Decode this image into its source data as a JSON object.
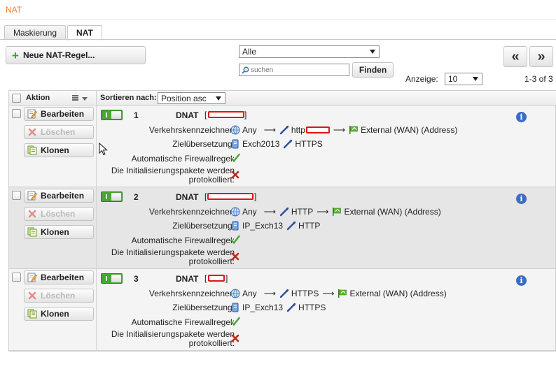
{
  "page": {
    "title": "NAT"
  },
  "tabs": [
    {
      "label": "Maskierung",
      "active": false
    },
    {
      "label": "NAT",
      "active": true
    }
  ],
  "toolbar": {
    "new_rule_label": "Neue NAT-Regel...",
    "filter_value": "Alle",
    "search_placeholder": "suchen",
    "find_label": "Finden",
    "prev_label": "«",
    "next_label": "»",
    "show_label": "Anzeige:",
    "show_value": "10",
    "range_text": "1-3 of 3"
  },
  "table": {
    "action_header": "Aktion",
    "sort_label": "Sortieren nach:",
    "sort_value": "Position asc"
  },
  "actions": {
    "edit_label": "Bearbeiten",
    "delete_label": "Löschen",
    "clone_label": "Klonen"
  },
  "labels": {
    "traffic": "Verkehrskennzeichner:",
    "target": "Zielübersetzung:",
    "auto_fw": "Automatische Firewallregel:",
    "log_line1": "Die Initialisierungspakete werden",
    "log_line2": "protokolliert:"
  },
  "rules": [
    {
      "number": "1",
      "type": "DNAT",
      "enabled": true,
      "traffic_source": "Any",
      "traffic_service": "http",
      "traffic_dest": "External (WAN) (Address)",
      "target_host": "Exch2013",
      "target_service": "HTTPS",
      "auto_firewall": true,
      "log_initial": false
    },
    {
      "number": "2",
      "type": "DNAT",
      "enabled": true,
      "traffic_source": "Any",
      "traffic_service": "HTTP",
      "traffic_dest": "External (WAN) (Address)",
      "target_host": "IP_Exch13",
      "target_service": "HTTP",
      "auto_firewall": true,
      "log_initial": false
    },
    {
      "number": "3",
      "type": "DNAT",
      "enabled": true,
      "traffic_source": "Any",
      "traffic_service": "HTTPS",
      "traffic_dest": "External (WAN) (Address)",
      "target_host": "IP_Exch13",
      "target_service": "HTTPS",
      "auto_firewall": true,
      "log_initial": false
    }
  ],
  "icons": {
    "new_rule": "plus-icon",
    "search": "magnifier-icon",
    "edit": "pencil-icon",
    "delete": "x-icon",
    "clone": "copy-icon",
    "any": "globe-icon",
    "service": "plug-icon",
    "wan": "flag-icon",
    "host": "server-icon",
    "check": "check-icon",
    "cross": "red-x-icon",
    "info": "info-icon"
  },
  "colors": {
    "title": "#e8843c",
    "toggle_on": "#46a832",
    "check": "#4aa338",
    "cross": "#c4261c",
    "info": "#3b6dc7",
    "redaction": "#e01515"
  }
}
